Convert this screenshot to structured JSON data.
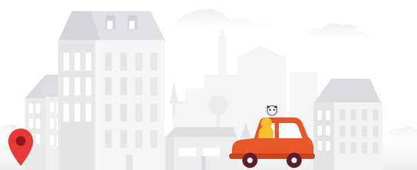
{
  "scene": {
    "description_free": true
  },
  "colors": {
    "background": "#ffffff",
    "building_light": "#f1f1f2",
    "building_mid": "#e4e5e7",
    "building_dark": "#d7d9dc",
    "window": "#ffffff",
    "car_body": "#e8572a",
    "car_dark": "#c9431c",
    "wheel": "#5a1f2a",
    "hubcap": "#ffffff",
    "pin": "#e53935",
    "pin_dark": "#b71c1c",
    "dog": "#f6c12e"
  },
  "icons": [
    "map-pin-icon"
  ]
}
